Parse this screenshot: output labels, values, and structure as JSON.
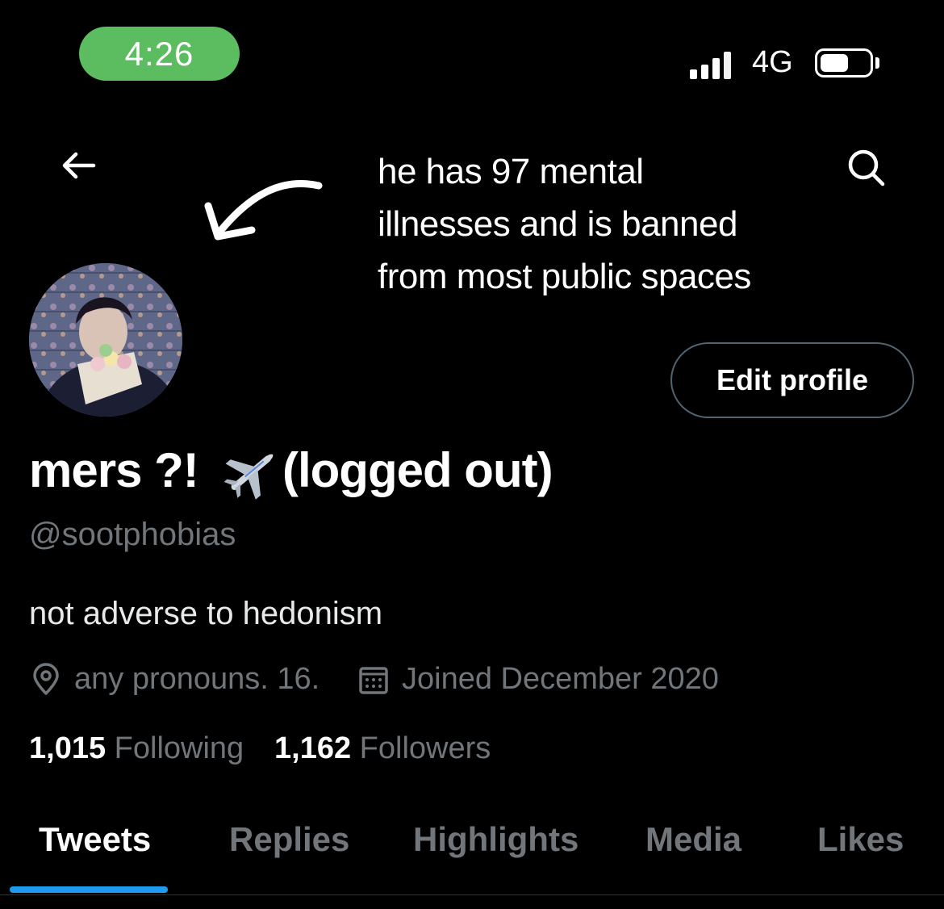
{
  "status_bar": {
    "time": "4:26",
    "network": "4G"
  },
  "header": {
    "banner_lines": [
      "he has 97 mental",
      "illnesses and is banned",
      "from most public spaces"
    ]
  },
  "profile": {
    "edit_button": "Edit profile",
    "display_name_prefix": "mers ?!",
    "display_name_emoji": "airplane",
    "display_name_suffix": "(logged out)",
    "handle": "@sootphobias",
    "bio": "not adverse to hedonism",
    "location": "any pronouns. 16.",
    "joined": "Joined December 2020",
    "following_count": "1,015",
    "following_label": "Following",
    "followers_count": "1,162",
    "followers_label": "Followers"
  },
  "tabs": [
    {
      "label": "Tweets",
      "active": true
    },
    {
      "label": "Replies"
    },
    {
      "label": "Highlights"
    },
    {
      "label": "Media"
    },
    {
      "label": "Likes"
    }
  ],
  "colors": {
    "background": "#000000",
    "accent": "#1d9bf0",
    "time_pill": "#5bbd5f",
    "muted_text": "#71767b"
  }
}
